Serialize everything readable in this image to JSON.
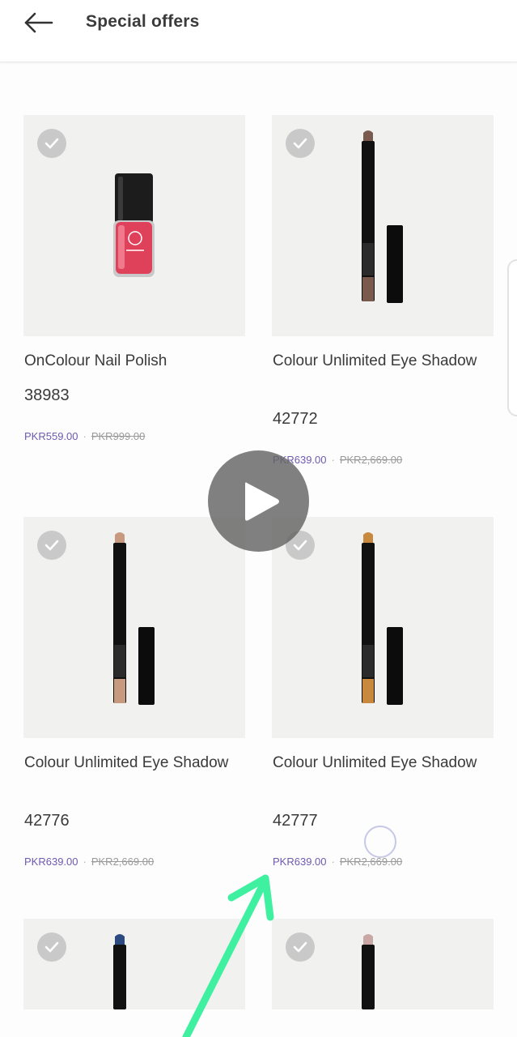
{
  "header": {
    "title": "Special offers",
    "back_icon": "arrow-left-icon"
  },
  "products": [
    {
      "name": "OnColour Nail Polish",
      "code": "38983",
      "price": "PKR559.00",
      "old_price": "PKR999.00"
    },
    {
      "name": "Colour Unlimited Eye Shadow",
      "code": "42772",
      "price": "PKR639.00",
      "old_price": "PKR2,669.00"
    },
    {
      "name": "Colour Unlimited Eye Shadow",
      "code": "42776",
      "price": "PKR639.00",
      "old_price": "PKR2,669.00"
    },
    {
      "name": "Colour Unlimited Eye Shadow",
      "code": "42777",
      "price": "PKR639.00",
      "old_price": "PKR2,669.00"
    }
  ],
  "separator": "·",
  "overlay": {
    "icon": "play-icon"
  },
  "colors": {
    "sale_price": "#6e5ab0",
    "card_bg": "#f1f1ef",
    "check_badge": "#c9c9c9",
    "annotation_arrow": "#3ef0a0"
  }
}
